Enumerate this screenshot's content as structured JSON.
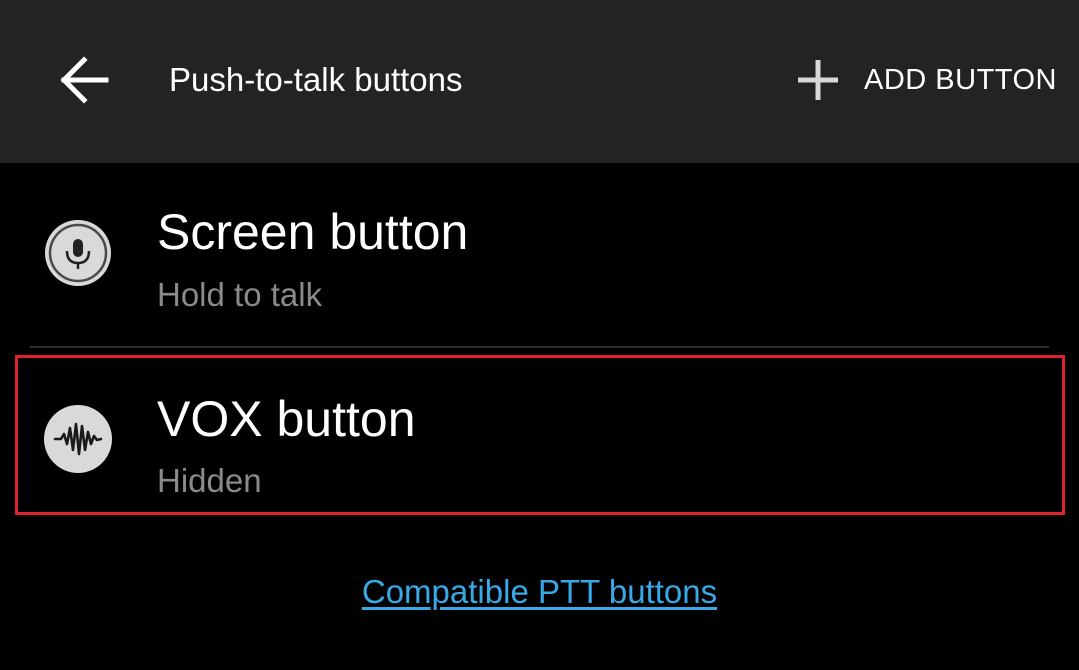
{
  "app_bar": {
    "back_icon": "arrow-left-icon",
    "title": "Push-to-talk buttons",
    "add_button": {
      "icon": "plus-icon",
      "label": "ADD BUTTON"
    },
    "background_color": "#232323"
  },
  "buttons_list": [
    {
      "icon": "microphone-icon",
      "title": "Screen button",
      "subtitle": "Hold to talk"
    },
    {
      "icon": "waveform-icon",
      "title": "VOX button",
      "subtitle": "Hidden",
      "highlighted": true
    }
  ],
  "compatible_link": "Compatible PTT buttons",
  "colors": {
    "background": "#000000",
    "subtitle_text": "#8a8a8a",
    "link": "#38a9e6",
    "highlight_border": "#e0202a",
    "icon_circle": "#d9d9d9"
  }
}
